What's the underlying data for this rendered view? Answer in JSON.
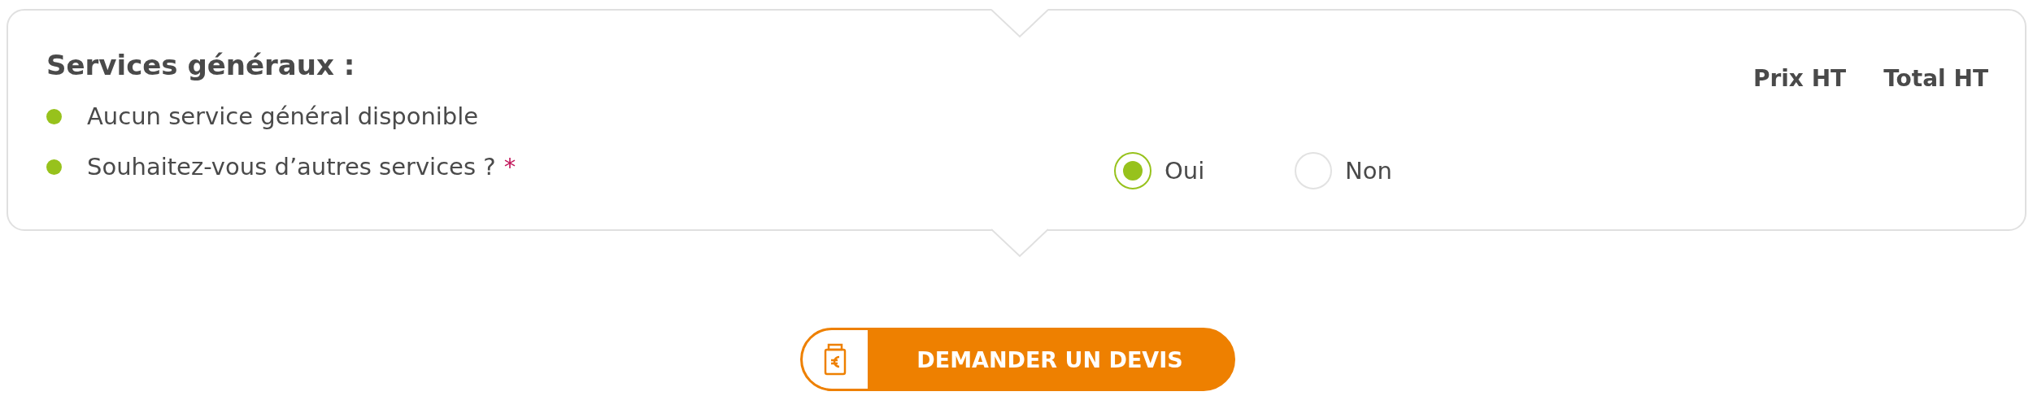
{
  "section": {
    "title": "Services généraux :",
    "items": [
      {
        "text": "Aucun service général disponible"
      },
      {
        "text": "Souhaitez-vous d’autres services ?",
        "required_mark": "*"
      }
    ],
    "options": [
      {
        "label": "Oui",
        "selected": true
      },
      {
        "label": "Non",
        "selected": false
      }
    ],
    "columns": [
      "Prix HT",
      "Total HT"
    ]
  },
  "button": {
    "label": "DEMANDER UN DEVIS"
  }
}
